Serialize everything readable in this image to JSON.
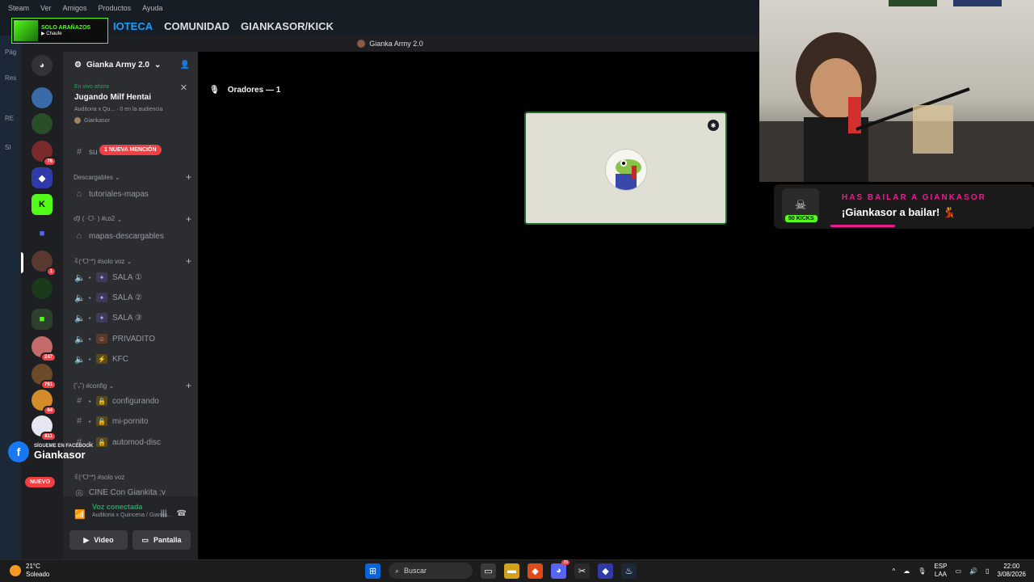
{
  "steam": {
    "menu": [
      "Steam",
      "Ver",
      "Amigos",
      "Productos",
      "Ayuda"
    ],
    "nav": [
      "BIBLIOTECA",
      "COMUNIDAD",
      "GIANKASOR/KICK"
    ],
    "nav_active_visible": "IOTECA",
    "left_labels": [
      "Pág",
      "Res",
      "RE",
      "SI"
    ]
  },
  "discord": {
    "window_title": "Gianka Army 2.0",
    "server_name": "Gianka Army 2.0",
    "live": {
      "now": "En vivo ahora",
      "title": "Jugando Milf Hentai",
      "meta": "Auditoria x Qu...  ·  0 en la audiencia",
      "user": "Giankasor"
    },
    "mention_badge": "1 NUEVA MENCIÓN",
    "channels": {
      "su": "su",
      "cat_descargables": "Descargables",
      "tutoriales": "tutoriales-mapas",
      "cat_ldz": "ʛ]l ( ·ᗜ· ) #ʟᴅ2",
      "mapas": "mapas-descargables",
      "cat_solo_voz": "ꉂ(ᵔᗜᵔ*) #solo voz",
      "sala1": "SALA ①",
      "sala2": "SALA ②",
      "sala3": "SALA ③",
      "privadito": "PRIVADITO",
      "kfc": "KFC",
      "cat_config": "(˘ᵥ˘) #config",
      "configurando": "configurando",
      "mi_pornito": "mi-pornito",
      "automod": "automod-disc",
      "cat_solo_voz2": "ꉂ(ᵔᗜᵔ*) #solo voz",
      "cine": "CINE Con Giankita :v"
    },
    "voice": {
      "status": "Voz conectada",
      "sub": "Auditoria x Quincena / Gianka...",
      "video": "Video",
      "screen": "Pantalla"
    },
    "stage": {
      "speakers_label": "Oradores — 1"
    },
    "server_badges": [
      "76",
      "1",
      "247",
      "761",
      "64",
      "811"
    ]
  },
  "overlays": {
    "brand_line1": "SOLO ARAÑAZOS",
    "brand_line2": "▶ Chaufe",
    "fb_small": "SÍGUEME EN FACEBOOK",
    "fb_big": "Giankasor",
    "nuevo": "NUEVO",
    "alert_top": "HAS BAILAR A GIANKASOR",
    "alert_main": "¡Giankasor a bailar! 💃",
    "alert_kicks": "50 KICKS"
  },
  "taskbar": {
    "temp": "21°C",
    "weather": "Soleado",
    "search": "Buscar",
    "lang1": "ESP",
    "lang2": "LAA",
    "time": "22:00",
    "date": "3/08/2026",
    "discord_badge": "25"
  },
  "colors": {
    "discord_bg": "#2b2d31",
    "discord_green": "#23a55a",
    "discord_red": "#f23f43",
    "steam_blue": "#1a9fff",
    "kick_green": "#53fc18",
    "alert_pink": "#e91e8c"
  }
}
